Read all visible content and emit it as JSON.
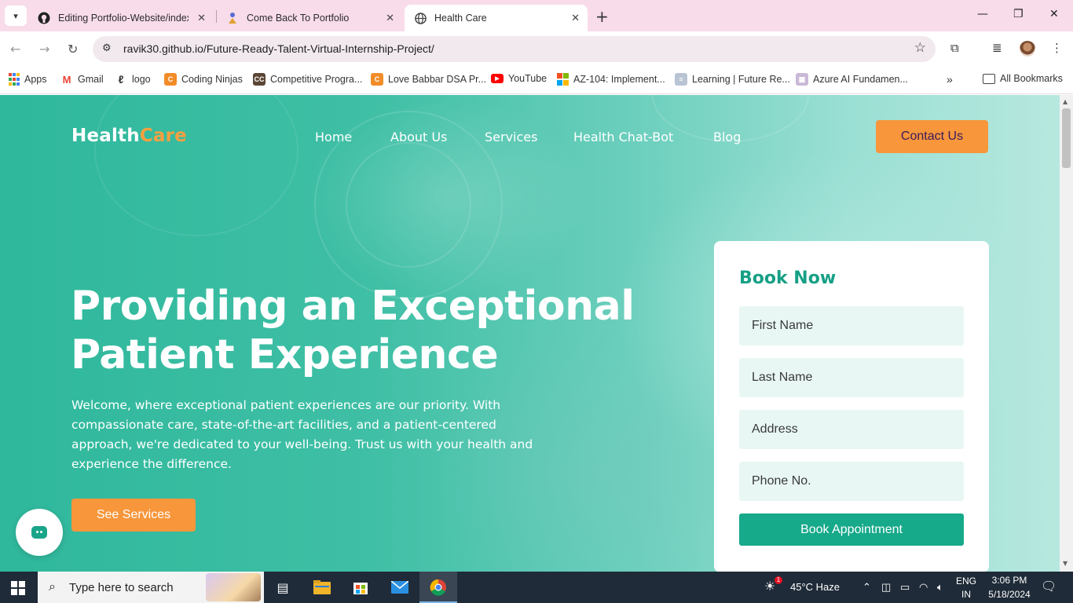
{
  "browser": {
    "tabs": [
      {
        "title": "Editing Portfolio-Website/index.h",
        "icon": "github-icon"
      },
      {
        "title": "Come Back To Portfolio",
        "icon": "person-icon"
      },
      {
        "title": "Health Care",
        "icon": "globe-icon",
        "active": true
      }
    ],
    "url": "ravik30.github.io/Future-Ready-Talent-Virtual-Internship-Project/",
    "bookmarks": [
      {
        "label": "Apps",
        "icon": "apps-grid-icon"
      },
      {
        "label": "Gmail",
        "icon": "gmail-icon"
      },
      {
        "label": "logo",
        "icon": "logo-icon"
      },
      {
        "label": "Coding Ninjas",
        "icon": "coding-ninjas-icon"
      },
      {
        "label": "Competitive Progra...",
        "icon": "cc-icon"
      },
      {
        "label": "Love Babbar DSA Pr...",
        "icon": "coding-ninjas-icon"
      },
      {
        "label": "YouTube",
        "icon": "youtube-icon"
      },
      {
        "label": "AZ-104: Implement...",
        "icon": "microsoft-icon"
      },
      {
        "label": "Learning | Future Re...",
        "icon": "learning-icon"
      },
      {
        "label": "Azure AI Fundamen...",
        "icon": "azure-icon"
      }
    ],
    "all_bookmarks": "All Bookmarks"
  },
  "site": {
    "logo_health": "Health",
    "logo_care": "Care",
    "nav": [
      "Home",
      "About Us",
      "Services",
      "Health Chat-Bot",
      "Blog"
    ],
    "contact_label": "Contact Us",
    "hero_title": "Providing an Exceptional Patient Experience",
    "hero_subtitle": "Welcome, where exceptional patient experiences are our priority. With compassionate care, state-of-the-art facilities, and a patient-centered approach, we're dedicated to your well-being. Trust us with your health and experience the difference.",
    "services_label": "See Services",
    "booking": {
      "title": "Book Now",
      "first_name": "First Name",
      "last_name": "Last Name",
      "address": "Address",
      "phone": "Phone No.",
      "submit": "Book Appointment"
    },
    "colors": {
      "teal": "#16a085",
      "orange": "#f7963b"
    }
  },
  "taskbar": {
    "search_placeholder": "Type here to search",
    "weather": "45°C  Haze",
    "weather_badge": "1",
    "lang_1": "ENG",
    "lang_2": "IN",
    "time": "3:06 PM",
    "date": "5/18/2024"
  }
}
